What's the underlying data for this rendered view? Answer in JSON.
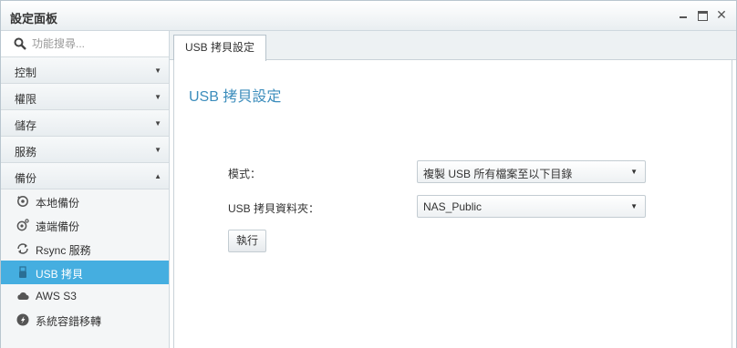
{
  "window": {
    "title": "設定面板"
  },
  "sidebar": {
    "search_placeholder": "功能搜尋...",
    "categories": [
      {
        "label": "控制",
        "expanded": false
      },
      {
        "label": "權限",
        "expanded": false
      },
      {
        "label": "儲存",
        "expanded": false
      },
      {
        "label": "服務",
        "expanded": false
      },
      {
        "label": "備份",
        "expanded": true
      }
    ],
    "items": [
      {
        "label": "本地備份",
        "icon": "local-backup-icon"
      },
      {
        "label": "遠端備份",
        "icon": "remote-backup-icon"
      },
      {
        "label": "Rsync 服務",
        "icon": "sync-icon"
      },
      {
        "label": "USB 拷貝",
        "icon": "usb-icon",
        "active": true
      },
      {
        "label": "AWS S3",
        "icon": "cloud-icon"
      },
      {
        "label": "系統容錯移轉",
        "icon": "failover-icon"
      }
    ]
  },
  "main": {
    "tab_label": "USB 拷貝設定",
    "section_title": "USB 拷貝設定",
    "mode_label": "模式：",
    "mode_value": "複製 USB 所有檔案至以下目錄",
    "folder_label": "USB 拷貝資料夾：",
    "folder_value": "NAS_Public",
    "execute_label": "執行"
  },
  "colors": {
    "accent": "#45aee0",
    "section_title": "#3c8dbc"
  }
}
